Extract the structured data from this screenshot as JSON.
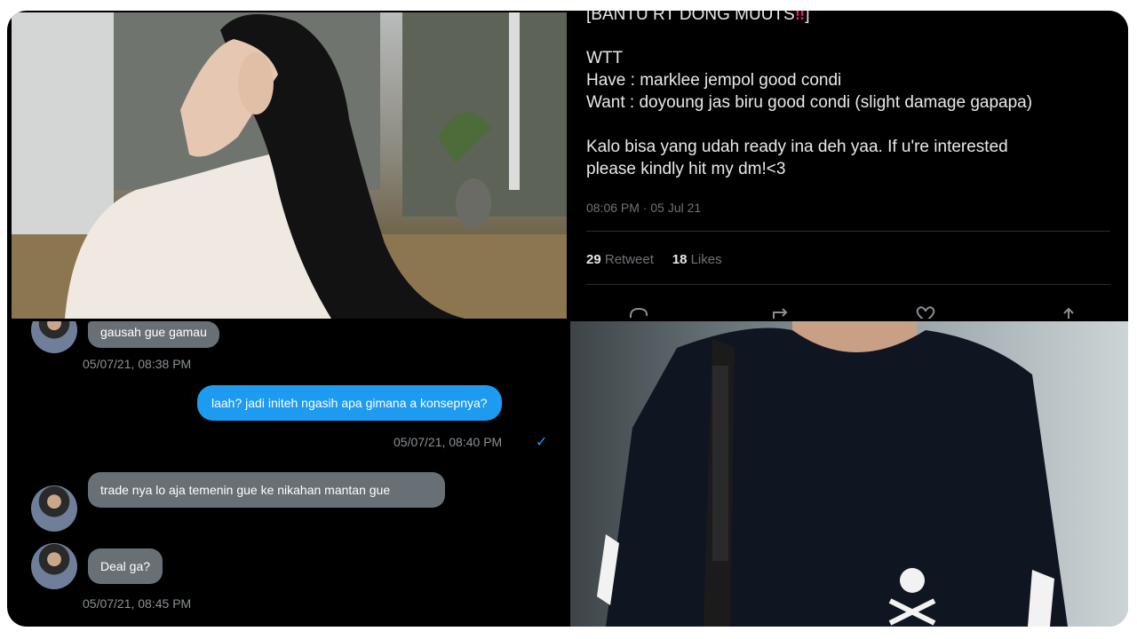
{
  "tweet": {
    "header_line": "[BANTU RT DONG MUUTS",
    "header_emoji": "‼",
    "header_close": "]",
    "lines": [
      "WTT",
      "Have : marklee jempol good condi",
      "Want : doyoung jas biru good condi (slight damage gapapa)",
      "",
      "Kalo bisa yang udah ready ina deh yaa. If u're interested",
      "please kindly hit my dm!<3"
    ],
    "timestamp": "08:06 PM · 05 Jul 21",
    "retweet_count": "29",
    "retweet_label": "Retweet",
    "likes_count": "18",
    "likes_label": "Likes",
    "icons": [
      "reply-icon",
      "retweet-icon",
      "like-icon",
      "share-icon"
    ]
  },
  "dm": {
    "messages": [
      {
        "from": "them",
        "text": "gausah gue gamau",
        "time": "05/07/21, 08:38 PM"
      },
      {
        "from": "me",
        "text": "laah? jadi initeh ngasih apa gimana a konsepnya?",
        "time": "05/07/21, 08:40 PM",
        "status": "✓"
      },
      {
        "from": "them",
        "text": "trade nya lo aja temenin gue ke nikahan mantan gue",
        "time": ""
      },
      {
        "from": "them",
        "text": "Deal ga?",
        "time": "05/07/21, 08:45 PM"
      }
    ]
  },
  "colors": {
    "frame_bg": "#000000",
    "sent_bubble": "#1d9bf0",
    "received_bubble": "#687076",
    "muted_text": "#6e7378"
  }
}
